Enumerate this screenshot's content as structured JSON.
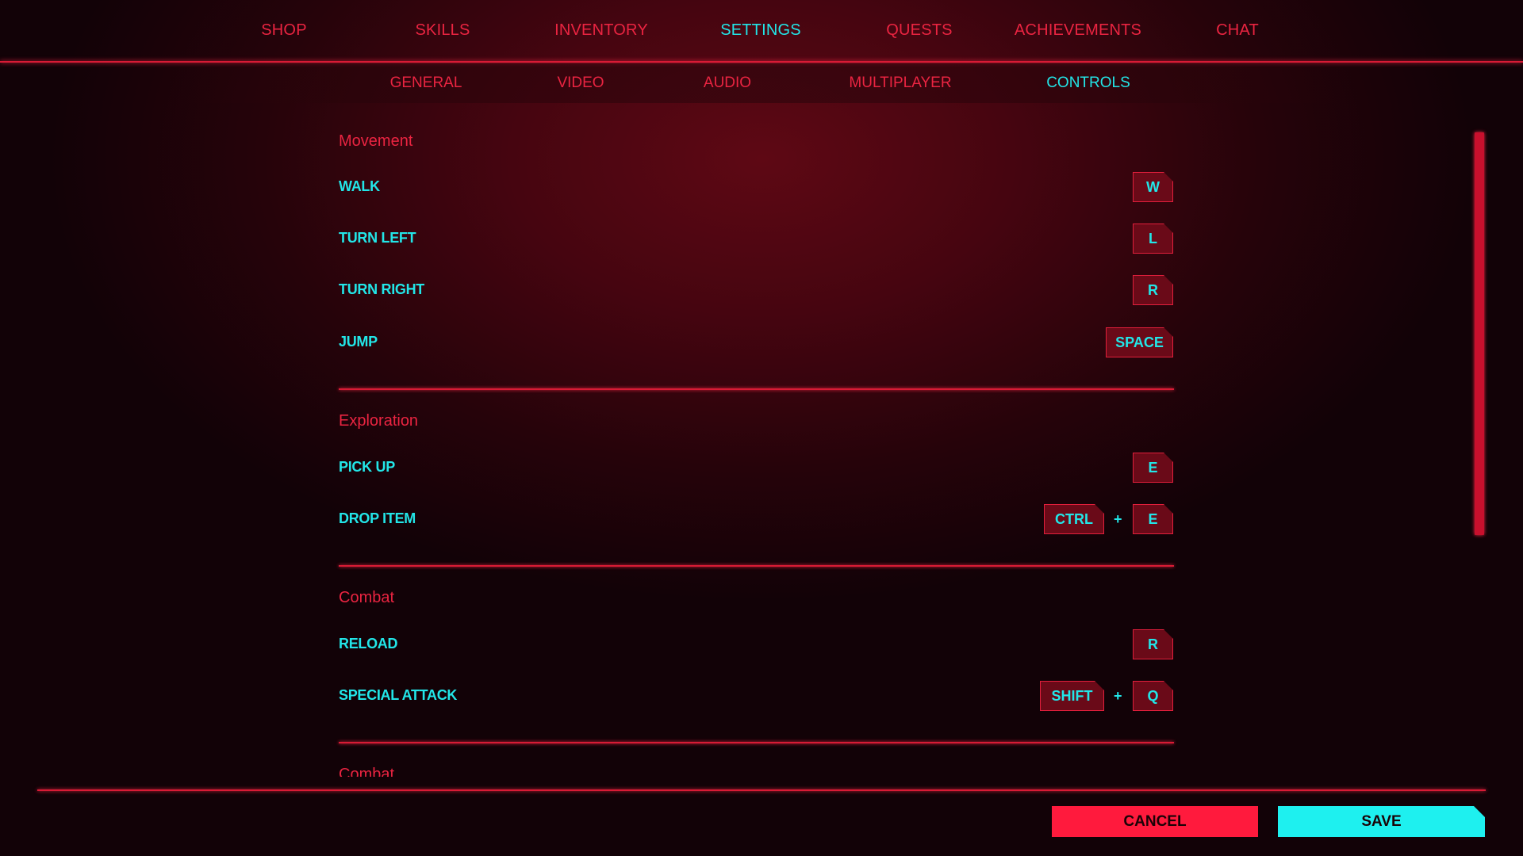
{
  "top_tabs": [
    {
      "label": "SHOP",
      "active": false
    },
    {
      "label": "SKILLS",
      "active": false
    },
    {
      "label": "INVENTORY",
      "active": false
    },
    {
      "label": "SETTINGS",
      "active": true
    },
    {
      "label": "QUESTS",
      "active": false
    },
    {
      "label": "ACHIEVEMENTS",
      "active": false
    },
    {
      "label": "CHAT",
      "active": false
    }
  ],
  "sub_tabs": [
    {
      "label": "GENERAL",
      "active": false
    },
    {
      "label": "VIDEO",
      "active": false
    },
    {
      "label": "AUDIO",
      "active": false
    },
    {
      "label": "MULTIPLAYER",
      "active": false
    },
    {
      "label": "CONTROLS",
      "active": true
    }
  ],
  "sections": [
    {
      "title": "Movement",
      "rows": [
        {
          "label": "WALK",
          "keys": [
            "W"
          ]
        },
        {
          "label": "TURN LEFT",
          "keys": [
            "L"
          ]
        },
        {
          "label": "TURN RIGHT",
          "keys": [
            "R"
          ]
        },
        {
          "label": "JUMP",
          "keys": [
            "SPACE"
          ]
        }
      ]
    },
    {
      "title": "Exploration",
      "rows": [
        {
          "label": "PICK UP",
          "keys": [
            "E"
          ]
        },
        {
          "label": "DROP ITEM",
          "keys": [
            "CTRL",
            "E"
          ]
        }
      ]
    },
    {
      "title": "Combat",
      "rows": [
        {
          "label": "RELOAD",
          "keys": [
            "R"
          ]
        },
        {
          "label": "SPECIAL ATTACK",
          "keys": [
            "SHIFT",
            "Q"
          ]
        }
      ]
    },
    {
      "title": "Combat",
      "rows": []
    }
  ],
  "key_combo_separator": "+",
  "footer": {
    "cancel_label": "CANCEL",
    "save_label": "SAVE"
  },
  "colors": {
    "accent_red": "#ea2441",
    "accent_cyan": "#22e6e8",
    "cancel_bg": "#ff1a3d",
    "save_bg": "#1ef0ef"
  }
}
